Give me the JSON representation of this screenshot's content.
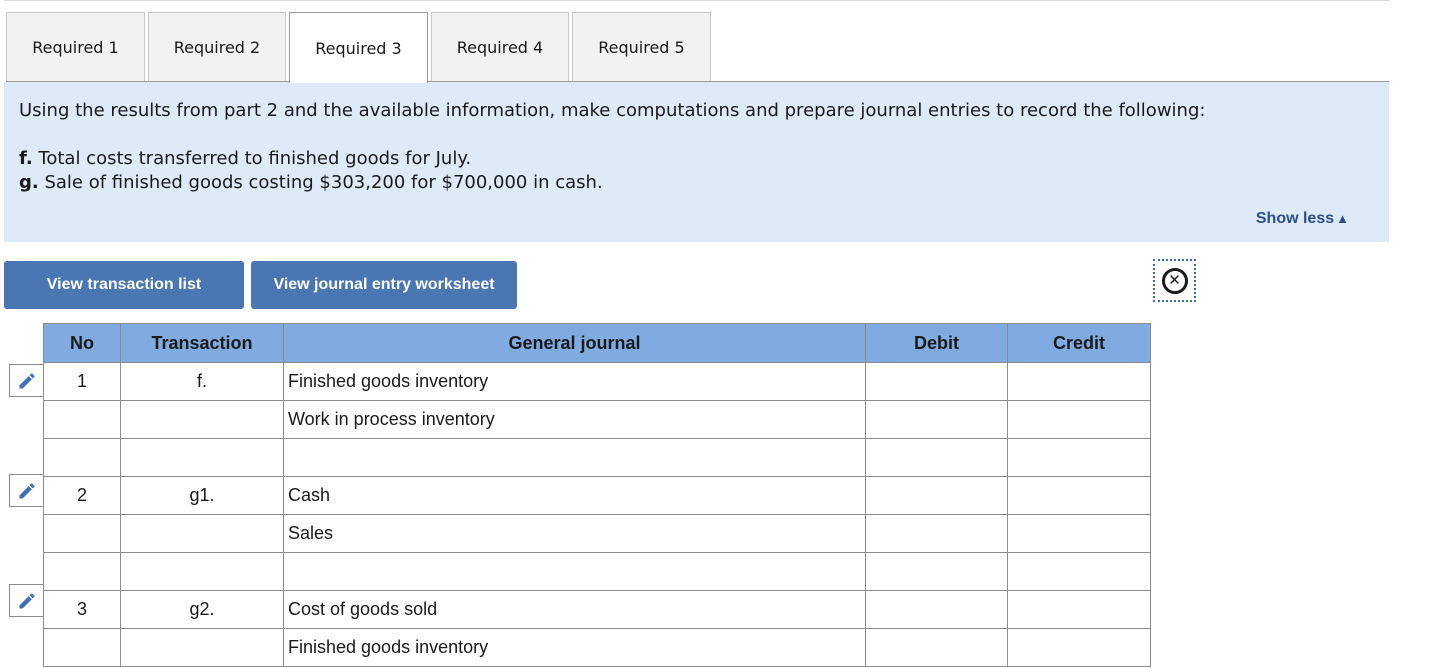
{
  "tabs": [
    {
      "label": "Required 1",
      "active": false
    },
    {
      "label": "Required 2",
      "active": false
    },
    {
      "label": "Required 3",
      "active": true
    },
    {
      "label": "Required 4",
      "active": false
    },
    {
      "label": "Required 5",
      "active": false
    }
  ],
  "prompt": {
    "intro": "Using the results from part 2 and the available information, make computations and prepare journal entries to record the following:",
    "items": [
      {
        "marker": "f.",
        "text": " Total costs transferred to finished goods for July."
      },
      {
        "marker": "g.",
        "text": " Sale of finished goods costing $303,200 for $700,000 in cash."
      }
    ],
    "show_less_label": "Show less",
    "show_less_icon": "triangle-up-icon"
  },
  "buttons": {
    "transaction_list": "View transaction list",
    "journal_worksheet": "View journal entry worksheet",
    "close_icon": "circled-x-icon"
  },
  "journal": {
    "headers": {
      "no": "No",
      "transaction": "Transaction",
      "general_journal": "General journal",
      "debit": "Debit",
      "credit": "Credit"
    },
    "rows": [
      {
        "no": "1",
        "transaction": "f.",
        "account": "Finished goods inventory",
        "debit": "",
        "credit": ""
      },
      {
        "no": "",
        "transaction": "",
        "account": "Work in process inventory",
        "debit": "",
        "credit": ""
      },
      {
        "no": "",
        "transaction": "",
        "account": "",
        "debit": "",
        "credit": ""
      },
      {
        "no": "2",
        "transaction": "g1.",
        "account": "Cash",
        "debit": "",
        "credit": ""
      },
      {
        "no": "",
        "transaction": "",
        "account": "Sales",
        "debit": "",
        "credit": ""
      },
      {
        "no": "",
        "transaction": "",
        "account": "",
        "debit": "",
        "credit": ""
      },
      {
        "no": "3",
        "transaction": "g2.",
        "account": "Cost of goods sold",
        "debit": "",
        "credit": ""
      },
      {
        "no": "",
        "transaction": "",
        "account": "Finished goods inventory",
        "debit": "",
        "credit": ""
      }
    ],
    "edit_icon": "pencil-icon"
  },
  "colors": {
    "accent": "#4a76b4",
    "header_bg": "#80abe0",
    "prompt_bg": "#deeaf7",
    "link": "#2a4f88"
  }
}
